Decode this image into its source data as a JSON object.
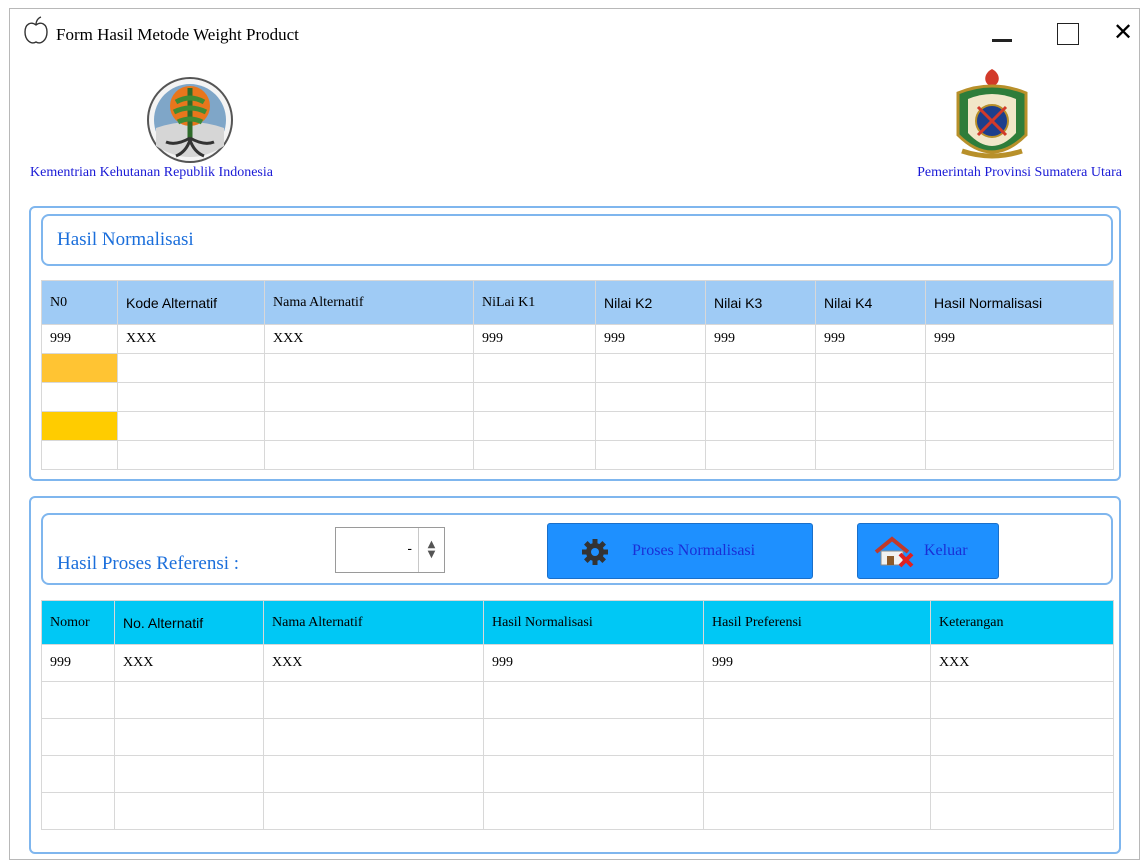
{
  "window": {
    "title": "Form Hasil Metode Weight Product",
    "controls": [
      "minimize-icon",
      "maximize-icon",
      "close-icon"
    ]
  },
  "header": {
    "left_caption": "Kementrian Kehutanan Republik Indonesia",
    "right_caption": "Pemerintah Provinsi Sumatera Utara",
    "left_logo": "ministry-forestry-emblem",
    "right_logo": "north-sumatra-coat-of-arms"
  },
  "normalisasi": {
    "title": "Hasil Normalisasi",
    "columns": [
      "N0",
      "Kode Alternatif",
      "Nama Alternatif",
      "NiLai K1",
      "Nilai K2",
      "Nilai K3",
      "Nilai K4",
      "Hasil Normalisasi"
    ],
    "rows": [
      [
        "999",
        "XXX",
        "XXX",
        "999",
        "999",
        "999",
        "999",
        "999"
      ],
      [
        "",
        "",
        "",
        "",
        "",
        "",
        "",
        ""
      ],
      [
        "",
        "",
        "",
        "",
        "",
        "",
        "",
        ""
      ],
      [
        "",
        "",
        "",
        "",
        "",
        "",
        "",
        ""
      ],
      [
        "",
        "",
        "",
        "",
        "",
        "",
        "",
        ""
      ]
    ]
  },
  "preferensi": {
    "title": "Hasil Proses Referensi :",
    "spinner_value": "-",
    "proses_button": "Proses Normalisasi",
    "keluar_button": "Keluar",
    "columns": [
      "Nomor",
      "No. Alternatif",
      "Nama Alternatif",
      "Hasil Normalisasi",
      "Hasil Preferensi",
      "Keterangan"
    ],
    "rows": [
      [
        "999",
        "XXX",
        "XXX",
        "999",
        "999",
        "XXX"
      ],
      [
        "",
        "",
        "",
        "",
        "",
        ""
      ],
      [
        "",
        "",
        "",
        "",
        "",
        ""
      ],
      [
        "",
        "",
        "",
        "",
        "",
        ""
      ],
      [
        "",
        "",
        "",
        "",
        "",
        ""
      ]
    ]
  },
  "colors": {
    "accent_border": "#7fb6ee",
    "heading_text": "#1a6edb",
    "table1_header": "#9fcbf5",
    "table2_header": "#00c8f5",
    "button_bg": "#1e90ff",
    "highlight_orange": "#ffc433",
    "highlight_yellow": "#ffcc00"
  }
}
